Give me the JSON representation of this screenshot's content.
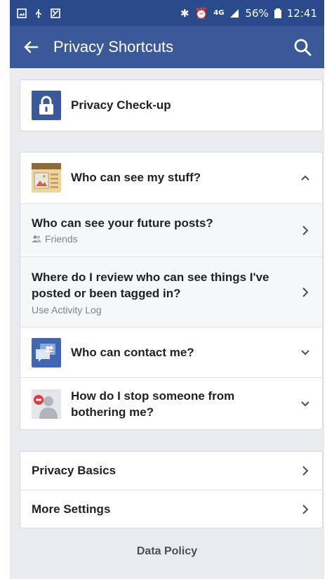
{
  "status_bar": {
    "battery": "56%",
    "time": "12:41",
    "network": "4G"
  },
  "app_bar": {
    "title": "Privacy Shortcuts"
  },
  "checkup": {
    "label": "Privacy Check-up"
  },
  "stuff": {
    "header": "Who can see my stuff?",
    "items": [
      {
        "title": "Who can see your future posts?",
        "subtitle": "Friends"
      },
      {
        "title": "Where do I review who can see things I've posted or been tagged in?",
        "subtitle": "Use Activity Log"
      }
    ]
  },
  "contact": {
    "label": "Who can contact me?"
  },
  "bothering": {
    "label": "How do I stop someone from bothering me?"
  },
  "settings": {
    "items": [
      {
        "label": "Privacy Basics"
      },
      {
        "label": "More Settings"
      }
    ]
  },
  "footer": {
    "label": "Data Policy"
  },
  "colors": {
    "brand": "#3b5998",
    "status_bar": "#2b4a8c",
    "background": "#e9ebee"
  }
}
